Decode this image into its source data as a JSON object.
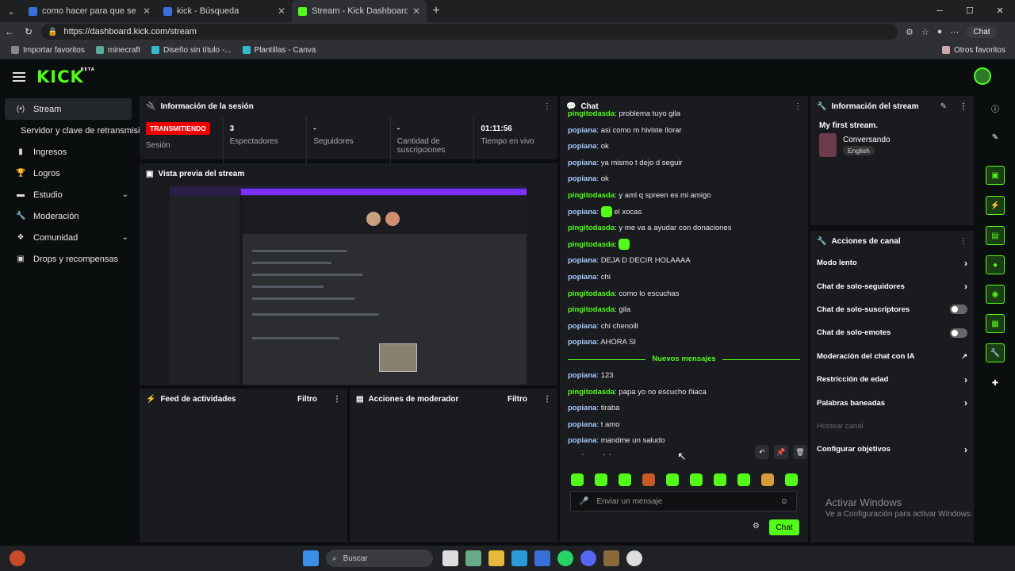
{
  "browser": {
    "tabs": [
      {
        "title": "como hacer para que se me escuc",
        "icon": "globe-icon",
        "active": false
      },
      {
        "title": "kick - Búsqueda",
        "icon": "search-icon",
        "active": false
      },
      {
        "title": "Stream - Kick Dashboard",
        "icon": "kick-icon",
        "active": true
      }
    ],
    "url": "https://dashboard.kick.com/stream",
    "chat_label": "Chat",
    "bookmarks": [
      "Importar favoritos",
      "minecraft",
      "Diseño sin título -...",
      "Plantillas - Canva"
    ],
    "bookmarks_right": "Otros favoritos"
  },
  "kick": {
    "logo": "KICK",
    "beta": "BETA"
  },
  "sidebar": {
    "items": [
      {
        "label": "Stream",
        "icon": "stream-icon"
      },
      {
        "label": "Servidor y clave de retransmisión",
        "icon": ""
      },
      {
        "label": "Ingresos",
        "icon": "chart-icon"
      },
      {
        "label": "Logros",
        "icon": "trophy-icon"
      },
      {
        "label": "Estudio",
        "icon": "studio-icon"
      },
      {
        "label": "Moderación",
        "icon": "wrench-icon"
      },
      {
        "label": "Comunidad",
        "icon": "community-icon"
      },
      {
        "label": "Drops y recompensas",
        "icon": "gift-icon"
      }
    ]
  },
  "session": {
    "title": "Información de la sesión",
    "live_badge": "TRANSMITIENDO",
    "session_label": "Sesión",
    "stats": [
      {
        "value": "3",
        "label": "Espectadores"
      },
      {
        "value": "-",
        "label": "Seguidores"
      },
      {
        "value": "-",
        "label": "Cantidad de suscripciones"
      },
      {
        "value": "01:11:56",
        "label": "Tiempo en vivo"
      }
    ]
  },
  "preview": {
    "title": "Vista previa del stream"
  },
  "feed": {
    "title": "Feed de actividades",
    "filter": "Filtro"
  },
  "modactions": {
    "title": "Acciones de moderador",
    "filter": "Filtro"
  },
  "chat": {
    "title": "Chat",
    "messages": [
      {
        "user": "pingitodasda",
        "text": "problema tuyo gila"
      },
      {
        "user": "popiana",
        "text": "asi como m hiviste llorar"
      },
      {
        "user": "popiana",
        "text": "ok"
      },
      {
        "user": "popiana",
        "text": "ya mismo t dejo d seguir"
      },
      {
        "user": "popiana",
        "text": "ok"
      },
      {
        "user": "pingitodasda",
        "text": "y aml q spreen es mi amigo"
      },
      {
        "user": "popiana",
        "text": "el xocas",
        "emote": true
      },
      {
        "user": "pingitodasda",
        "text": "y me va a ayudar con donaciones"
      },
      {
        "user": "pingitodasda",
        "text": "",
        "emote": true
      },
      {
        "user": "popiana",
        "text": "DEJA D DECIR HOLAAAA"
      },
      {
        "user": "popiana",
        "text": "chi"
      },
      {
        "user": "pingitodasda",
        "text": "como lo escuchas"
      },
      {
        "user": "pingitodasda",
        "text": "gila"
      },
      {
        "user": "popiana",
        "text": "chi chenoill"
      },
      {
        "user": "popiana",
        "text": "AHORA SI"
      }
    ],
    "new_label": "Nuevos mensajes",
    "new_messages": [
      {
        "user": "popiana",
        "text": "123"
      },
      {
        "user": "pingitodasda",
        "text": "papa yo no escucho ñiaca"
      },
      {
        "user": "popiana",
        "text": "tiraba"
      },
      {
        "user": "popiana",
        "text": "t amo"
      },
      {
        "user": "popiana",
        "text": "mandme un saludo"
      },
      {
        "user": "popiana",
        "text": "dale"
      }
    ],
    "input_placeholder": "Enviar un mensaje",
    "send_label": "Chat"
  },
  "stream_info": {
    "title": "Información del stream",
    "stream_title": "My first stream.",
    "category": "Conversando",
    "language": "English"
  },
  "channel_actions": {
    "title": "Acciones de canal",
    "items": [
      {
        "label": "Modo lento",
        "control": "arrow"
      },
      {
        "label": "Chat de solo-seguidores",
        "control": "arrow"
      },
      {
        "label": "Chat de solo-suscriptores",
        "control": "toggle"
      },
      {
        "label": "Chat de solo-emotes",
        "control": "toggle"
      },
      {
        "label": "Moderación del chat con IA",
        "control": "external"
      },
      {
        "label": "Restricción de edad",
        "control": "arrow"
      },
      {
        "label": "Palabras baneadas",
        "control": "arrow"
      },
      {
        "label": "Hostear canal",
        "control": "disabled"
      },
      {
        "label": "Configurar objetivos",
        "control": "arrow"
      }
    ]
  },
  "watermark": {
    "line1": "Activar Windows",
    "line2": "Ve a Configuración para activar Windows."
  },
  "taskbar": {
    "search": "Buscar"
  },
  "colors": {
    "accent": "#53fc18",
    "live": "#e00000",
    "panel": "#191b1f",
    "user_viewer": "#a9c9ff"
  }
}
